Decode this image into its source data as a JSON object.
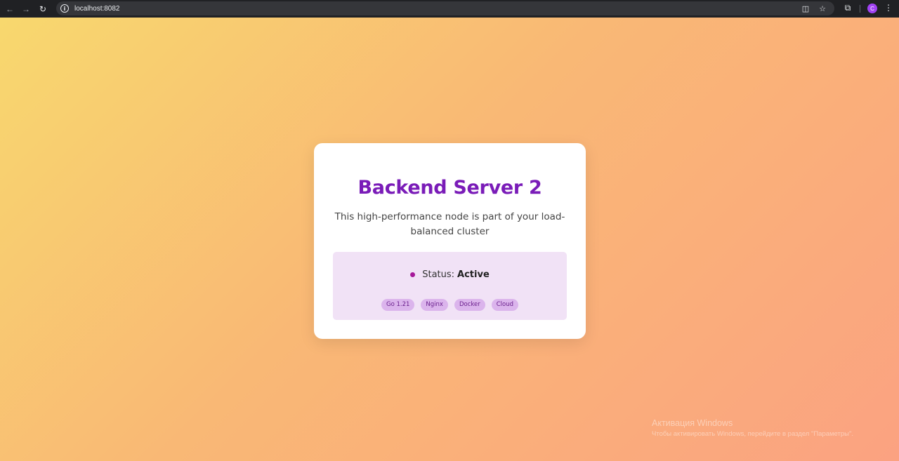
{
  "browser": {
    "url": "localhost:8082",
    "avatar_letter": "C",
    "icons": {
      "back": "arrow-left-icon",
      "forward": "arrow-right-icon",
      "reload": "reload-icon",
      "site_info": "info-icon",
      "translate": "translate-icon",
      "bookmark": "star-icon",
      "extensions": "puzzle-icon",
      "menu": "kebab-menu-icon"
    }
  },
  "card": {
    "title": "Backend Server 2",
    "description": "This high-performance node is part of your load-balanced cluster",
    "status_label": "Status:",
    "status_value": "Active",
    "tags": [
      "Go 1.21",
      "Nginx",
      "Docker",
      "Cloud"
    ]
  },
  "colors": {
    "title": "#7a1cb8",
    "status_dot": "#a6189a",
    "status_box": "#f1e2f6",
    "tag_bg": "#dbb4ec",
    "gradient_start": "#f8d86e",
    "gradient_end": "#fba281"
  },
  "watermark": {
    "title": "Активация Windows",
    "subtitle": "Чтобы активировать Windows, перейдите в раздел \"Параметры\"."
  }
}
